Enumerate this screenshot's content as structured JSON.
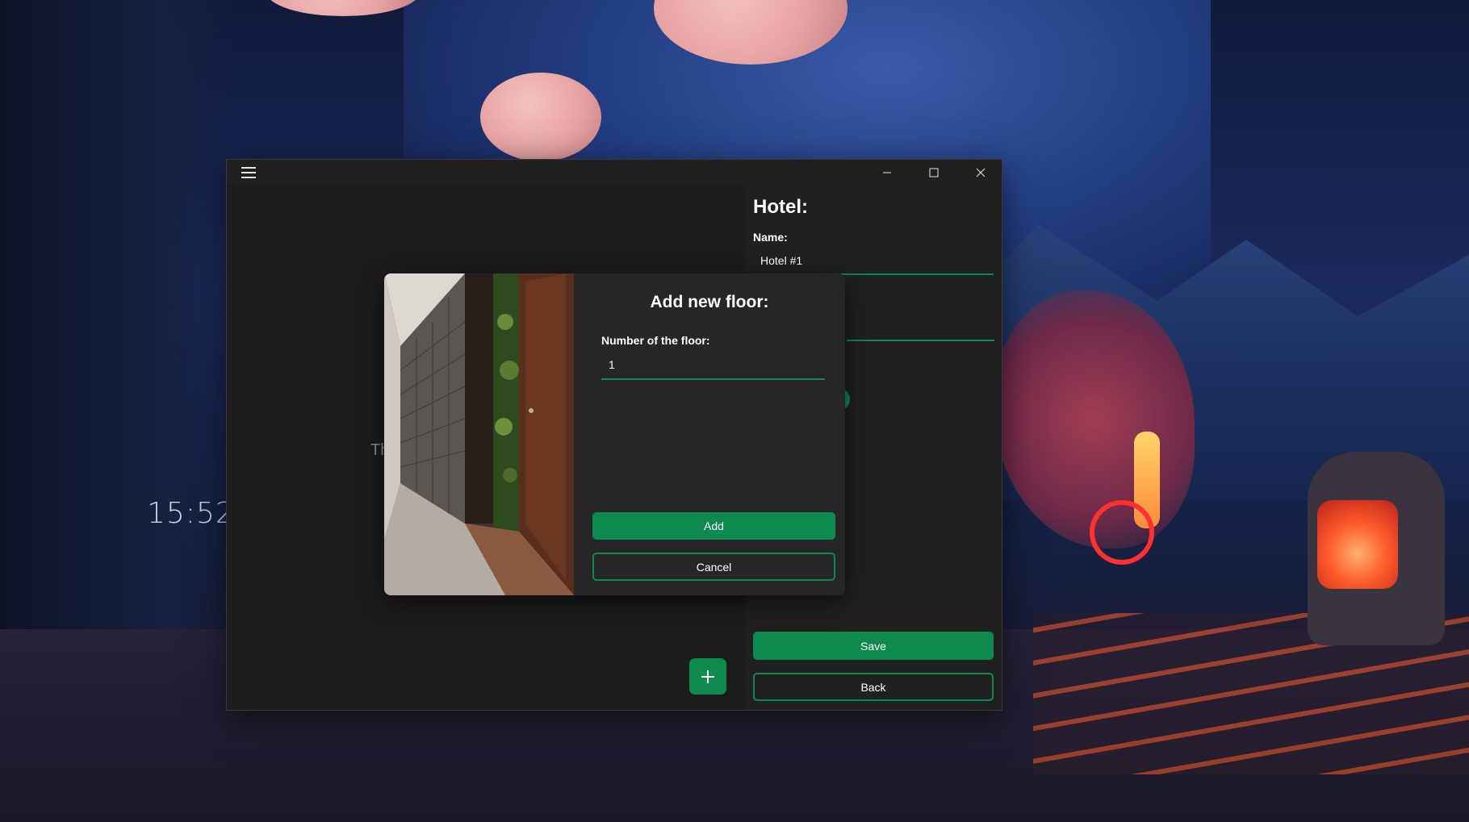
{
  "desktop": {
    "clock": "15:52"
  },
  "window": {
    "controls": {
      "minimize_icon": "minimize-icon",
      "maximize_icon": "maximize-icon",
      "close_icon": "close-icon"
    },
    "menu_icon": "hamburger-menu-icon"
  },
  "hotel_form": {
    "title": "Hotel:",
    "name_label": "Name:",
    "name_value": "Hotel #1",
    "save_label": "Save",
    "back_label": "Back"
  },
  "left_pane": {
    "partial_text": "Th",
    "fab_icon": "plus-icon"
  },
  "dialog": {
    "title": "Add new floor:",
    "floor_label": "Number of the floor:",
    "floor_value": "1",
    "add_label": "Add",
    "cancel_label": "Cancel"
  },
  "colors": {
    "accent": "#0e8a4e",
    "window_bg": "#1f1f1f",
    "dialog_bg": "#262626",
    "text": "#ffffff"
  }
}
